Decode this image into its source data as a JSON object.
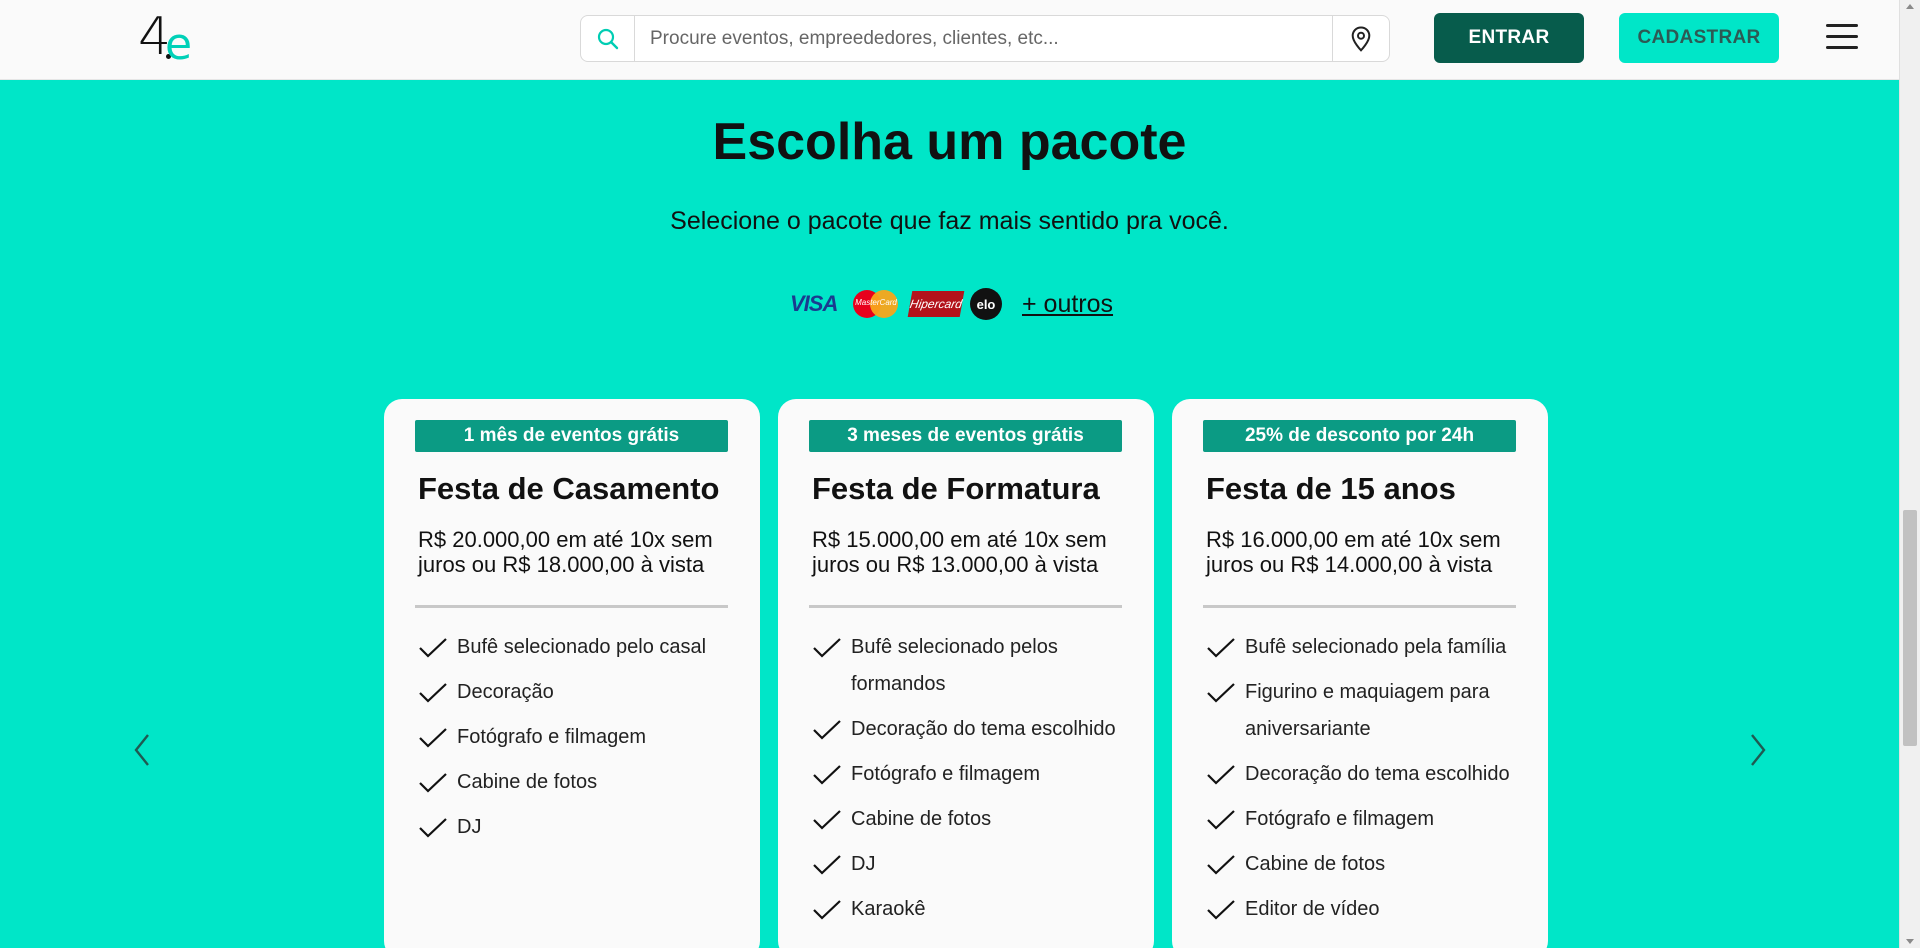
{
  "header": {
    "logo_number": "4",
    "logo_letter": "e",
    "search_placeholder": "Procure eventos, empreededores, clientes, etc...",
    "entrar_label": "ENTRAR",
    "cadastrar_label": "CADASTRAR"
  },
  "section": {
    "title": "Escolha um pacote",
    "subtitle": "Selecione o pacote que faz mais sentido pra você.",
    "payments": {
      "visa": "VISA",
      "mastercard": "MasterCard",
      "hipercard": "Hipercard",
      "elo": "elo",
      "others_link": "+ outros"
    }
  },
  "cards": [
    {
      "badge": "1 mês de eventos grátis",
      "name": "Festa de Casamento",
      "price": "R$ 20.000,00 em até 10x sem juros ou R$ 18.000,00 à vista",
      "items": [
        "Bufê selecionado pelo casal",
        "Decoração",
        "Fotógrafo e filmagem",
        "Cabine de fotos",
        "DJ"
      ]
    },
    {
      "badge": "3 meses de eventos grátis",
      "name": "Festa de Formatura",
      "price": "R$ 15.000,00 em até 10x sem juros ou R$ 13.000,00 à vista",
      "items": [
        "Bufê selecionado pelos formandos",
        "Decoração do tema escolhido",
        "Fotógrafo e filmagem",
        "Cabine de fotos",
        "DJ",
        "Karaokê"
      ]
    },
    {
      "badge": "25% de desconto por 24h",
      "name": "Festa de 15 anos",
      "price": "R$ 16.000,00 em até 10x sem juros ou R$ 14.000,00 à vista",
      "items": [
        "Bufê selecionado pela família",
        "Figurino e maquiagem para aniversariante",
        "Decoração do tema escolhido",
        "Fotógrafo e filmagem",
        "Cabine de fotos",
        "Editor de vídeo"
      ]
    }
  ],
  "icons": {
    "search": "search-icon",
    "location": "location-pin-icon",
    "menu": "hamburger-menu-icon",
    "prev": "chevron-left-icon",
    "next": "chevron-right-icon",
    "check": "check-icon"
  },
  "colors": {
    "background": "#00e6c8",
    "entrar": "#075c4c",
    "badge": "#0b9b84",
    "card": "#fafafa"
  }
}
